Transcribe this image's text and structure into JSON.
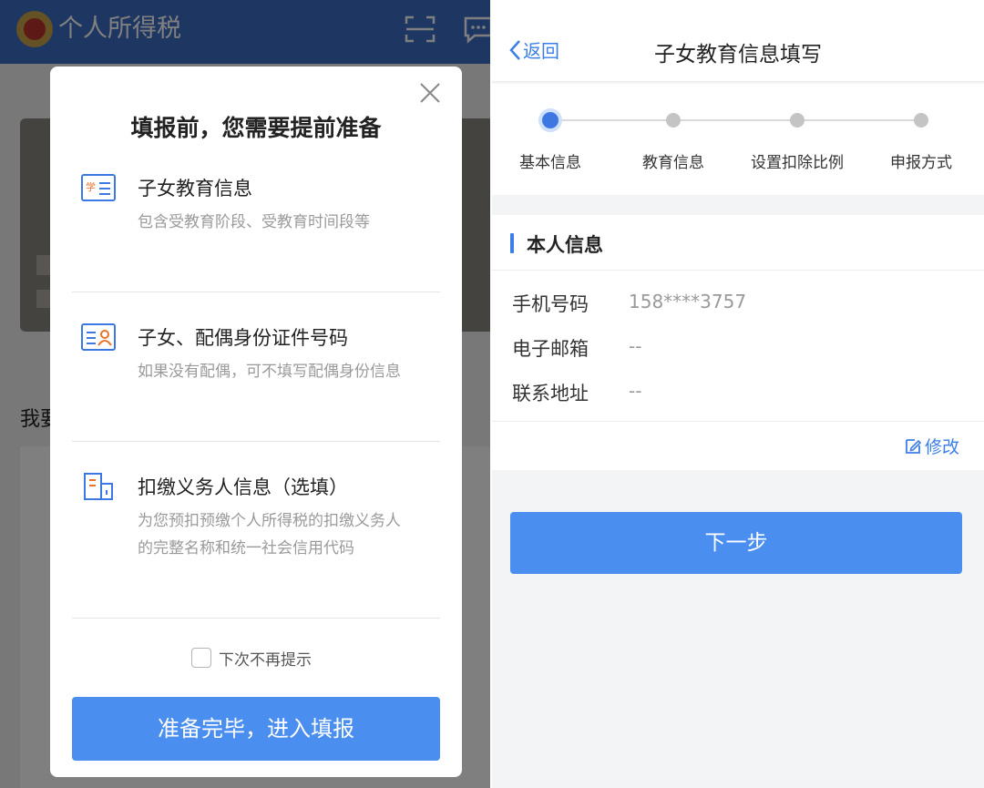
{
  "left": {
    "app_title": "个人所得税",
    "background_label": "我要",
    "modal": {
      "title": "填报前，您需要提前准备",
      "items": [
        {
          "icon": "student-card-icon",
          "title": "子女教育信息",
          "desc": "包含受教育阶段、受教育时间段等"
        },
        {
          "icon": "id-card-icon",
          "title": "子女、配偶身份证件号码",
          "desc": "如果没有配偶，可不填写配偶身份信息"
        },
        {
          "icon": "building-icon",
          "title": "扣缴义务人信息（选填）",
          "desc": "为您预扣预缴个人所得税的扣缴义务人的完整名称和统一社会信用代码"
        }
      ],
      "checkbox_label": "下次不再提示",
      "primary_button": "准备完毕，进入填报",
      "icon_text": "学"
    },
    "colors": {
      "header": "#3d6fc4",
      "primary": "#4a8ef0"
    }
  },
  "right": {
    "back_label": "返回",
    "title": "子女教育信息填写",
    "steps": [
      {
        "label": "基本信息",
        "active": true
      },
      {
        "label": "教育信息",
        "active": false
      },
      {
        "label": "设置扣除比例",
        "active": false
      },
      {
        "label": "申报方式",
        "active": false
      }
    ],
    "section_title": "本人信息",
    "fields": [
      {
        "key": "手机号码",
        "value": "158****3757"
      },
      {
        "key": "电子邮箱",
        "value": "--"
      },
      {
        "key": "联系地址",
        "value": "--"
      }
    ],
    "edit_label": "修改",
    "next_button": "下一步",
    "colors": {
      "accent": "#3b7ee8",
      "button": "#4a8ef0"
    }
  }
}
